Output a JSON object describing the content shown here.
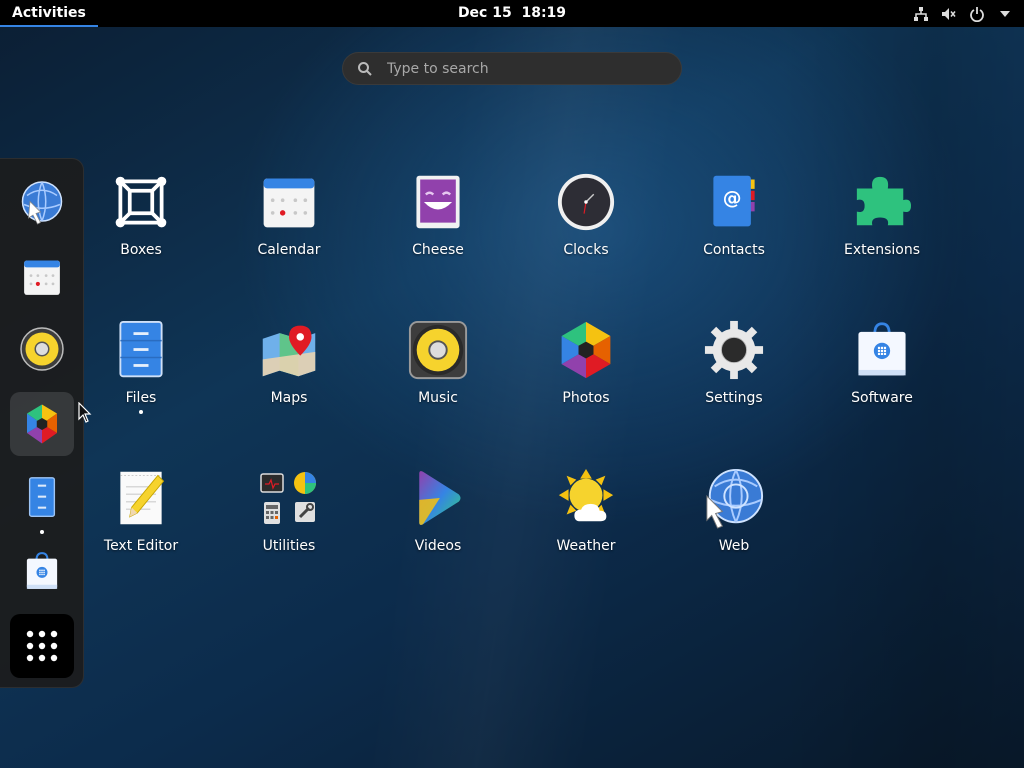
{
  "topbar": {
    "activities_label": "Activities",
    "date": "Dec 15",
    "time": "18:19",
    "tray_icons": [
      "network-icon",
      "volume-muted-icon",
      "power-icon",
      "chevron-down-icon"
    ]
  },
  "search": {
    "placeholder": "Type to search",
    "icon": "search-icon"
  },
  "dash": {
    "items": [
      {
        "name": "Web",
        "icon": "web-icon",
        "running": false,
        "active": false
      },
      {
        "name": "Calendar",
        "icon": "calendar-icon",
        "running": false,
        "active": false
      },
      {
        "name": "Music",
        "icon": "music-icon",
        "running": false,
        "active": false
      },
      {
        "name": "Photos",
        "icon": "photos-icon",
        "running": false,
        "active": true
      },
      {
        "name": "Files",
        "icon": "files-icon",
        "running": true,
        "active": false
      },
      {
        "name": "Software",
        "icon": "software-icon",
        "running": false,
        "active": false
      }
    ],
    "show_apps_icon": "app-grid-icon"
  },
  "apps": [
    {
      "label": "Boxes",
      "icon": "boxes-icon",
      "running": false
    },
    {
      "label": "Calendar",
      "icon": "calendar-icon",
      "running": false
    },
    {
      "label": "Cheese",
      "icon": "cheese-icon",
      "running": false
    },
    {
      "label": "Clocks",
      "icon": "clocks-icon",
      "running": false
    },
    {
      "label": "Contacts",
      "icon": "contacts-icon",
      "running": false
    },
    {
      "label": "Extensions",
      "icon": "extensions-icon",
      "running": false
    },
    {
      "label": "Files",
      "icon": "files-icon",
      "running": true
    },
    {
      "label": "Maps",
      "icon": "maps-icon",
      "running": false
    },
    {
      "label": "Music",
      "icon": "music-icon",
      "running": false
    },
    {
      "label": "Photos",
      "icon": "photos-icon",
      "running": false
    },
    {
      "label": "Settings",
      "icon": "settings-icon",
      "running": false
    },
    {
      "label": "Software",
      "icon": "software-icon",
      "running": false
    },
    {
      "label": "Text Editor",
      "icon": "text-editor-icon",
      "running": false
    },
    {
      "label": "Utilities",
      "icon": "utilities-folder-icon",
      "running": false
    },
    {
      "label": "Videos",
      "icon": "videos-icon",
      "running": false
    },
    {
      "label": "Weather",
      "icon": "weather-icon",
      "running": false
    },
    {
      "label": "Web",
      "icon": "web-icon",
      "running": false
    }
  ],
  "colors": {
    "accent": "#3584e4",
    "topbar": "#000000",
    "dash_bg": "#1c1c1c"
  }
}
